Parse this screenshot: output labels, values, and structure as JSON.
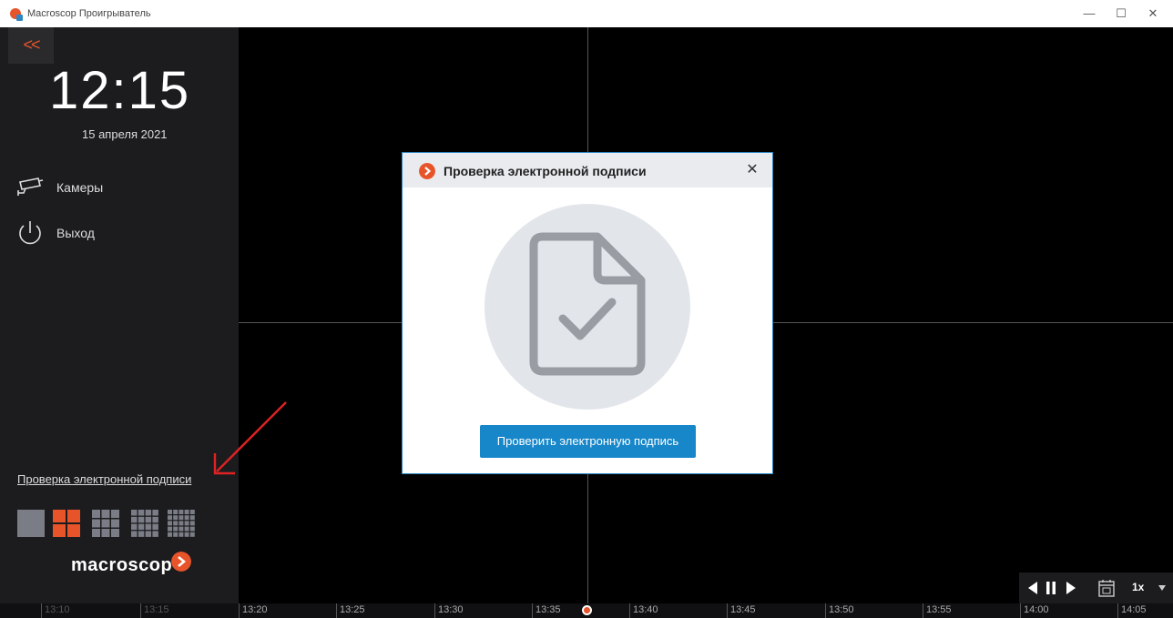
{
  "window": {
    "title": "Macroscop Проигрыватель",
    "minimize": "—",
    "maximize": "☐",
    "close": "✕"
  },
  "sidebar": {
    "collapse": "<<",
    "clock": "12:15",
    "date": "15 апреля 2021",
    "menu": [
      {
        "label": "Камеры",
        "icon": "camera-icon"
      },
      {
        "label": "Выход",
        "icon": "power-icon"
      }
    ],
    "signature_link": "Проверка электронной подписи",
    "layouts": [
      "1x1",
      "2x2",
      "3x3",
      "4x4",
      "5x5"
    ],
    "active_layout": "2x2",
    "logo": "macroscop"
  },
  "dialog": {
    "title": "Проверка электронной подписи",
    "close": "✕",
    "button": "Проверить электронную подпись"
  },
  "playback": {
    "speed": "1x"
  },
  "timeline": {
    "ticks": [
      "13:10",
      "13:15",
      "13:20",
      "13:25",
      "13:30",
      "13:35",
      "13:40",
      "13:45",
      "13:50",
      "13:55",
      "14:00",
      "14:05"
    ]
  },
  "colors": {
    "accent": "#e8542a",
    "button": "#1787c9",
    "sidebar": "#1c1c1f"
  }
}
